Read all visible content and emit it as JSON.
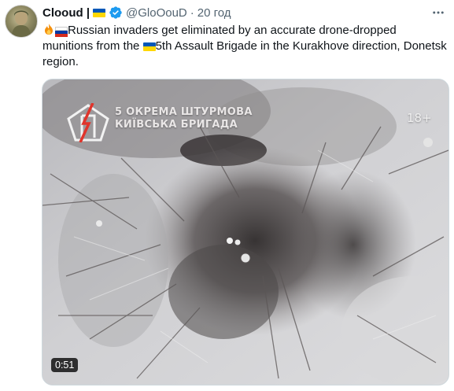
{
  "tweet": {
    "author_name": "Clooud |",
    "handle": "@GloOouD",
    "separator": "·",
    "time": "20 год",
    "text_part1": "Russian invaders get eliminated by an accurate drone-dropped munitions from the ",
    "text_part2": "5th Assault Brigade in the Kurakhove direction, Donetsk region."
  },
  "media": {
    "overlay_line1": "5 ОКРЕМА ШТУРМОВА",
    "overlay_line2": "КИЇВСЬКА БРИГАДА",
    "age_rating": "18+",
    "duration": "0:51"
  },
  "icons": {
    "flag_ua": "ukraine-flag-icon",
    "flag_ru": "russia-flag-icon",
    "fire": "fire-emoji-icon",
    "verified": "verified-badge-icon",
    "more": "more-options-icon"
  },
  "colors": {
    "text": "#0f1419",
    "secondary_text": "#536471",
    "verified_blue": "#1d9bf0",
    "flag_blue": "#0057b7",
    "flag_yellow": "#ffd700",
    "logo_red": "#e0342b"
  }
}
